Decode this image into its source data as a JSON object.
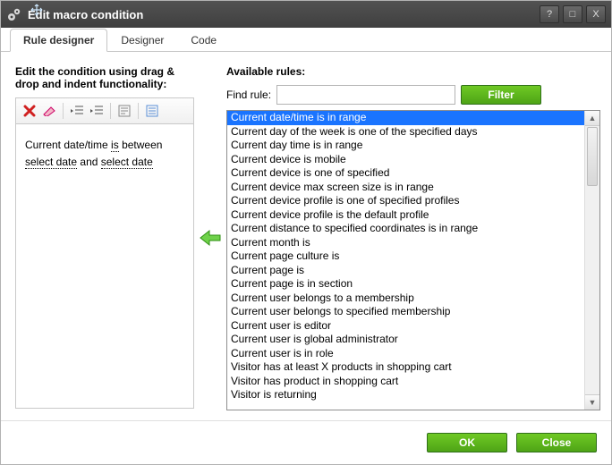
{
  "titlebar": {
    "title": "Edit macro condition",
    "help": "?",
    "max": "□",
    "close": "X"
  },
  "tabs": [
    {
      "label": "Rule designer",
      "active": true
    },
    {
      "label": "Designer",
      "active": false
    },
    {
      "label": "Code",
      "active": false
    }
  ],
  "left": {
    "heading": "Edit the condition using drag & drop and indent functionality:",
    "cond": {
      "p1": "Current date/time ",
      "op": "is",
      "p2": " between ",
      "d1": "select date",
      "p3": " and ",
      "d2": "select date"
    }
  },
  "right": {
    "heading": "Available rules:",
    "find_label": "Find rule:",
    "find_value": "",
    "filter_label": "Filter",
    "selected_index": 0,
    "rules": [
      "Current date/time is in range",
      "Current day of the week is one of the specified days",
      "Current day time is in range",
      "Current device is mobile",
      "Current device is one of specified",
      "Current device max screen size is in range",
      "Current device profile is one of specified profiles",
      "Current device profile is the default profile",
      "Current distance to specified coordinates is in range",
      "Current month is",
      "Current page culture is",
      "Current page is",
      "Current page is in section",
      "Current user belongs to a membership",
      "Current user belongs to specified membership",
      "Current user is editor",
      "Current user is global administrator",
      "Current user is in role",
      "Visitor has at least X products in shopping cart",
      "Visitor has product in shopping cart",
      "Visitor is returning"
    ]
  },
  "footer": {
    "ok": "OK",
    "close": "Close"
  }
}
